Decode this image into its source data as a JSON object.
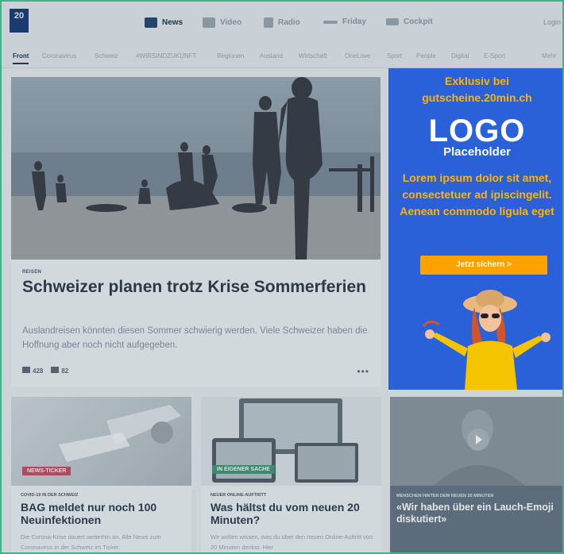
{
  "nav": {
    "logo": "20",
    "items": [
      {
        "label": "News",
        "icon": "news-grid-icon"
      },
      {
        "label": "Video",
        "icon": "video-play-icon"
      },
      {
        "label": "Radio",
        "icon": "radio-icon"
      },
      {
        "label": "Friday",
        "icon": "friday-icon"
      },
      {
        "label": "Cockpit",
        "icon": "cockpit-icon"
      }
    ],
    "login": "Login"
  },
  "subnav": [
    "Front",
    "Coronavirus",
    "Schweiz",
    "#WIRSINDZUKUNFT",
    "Regionen",
    "Ausland",
    "Wirtschaft",
    "OneLove",
    "Sport",
    "People",
    "Digital",
    "E-Sport",
    "Mehr"
  ],
  "hero": {
    "kicker": "REISEN",
    "headline": "Schweizer planen trotz Krise Sommerferien",
    "lead": "Auslandreisen könnten diesen Sommer schwierig werden. Viele Schweizer haben die Hoffnung aber noch nicht aufgegeben.",
    "likes": "428",
    "shares": "82",
    "more": "•••"
  },
  "ad": {
    "title": "Exklusiv bei gutscheine.20min.ch",
    "logo_big": "LOGO",
    "logo_small": "Placeholder",
    "body": "Lorem ipsum dolor sit amet, consectetuer ad ipiscingelit. Aenean commodo ligula eget",
    "button": "Jetzt sichern  >"
  },
  "cards": [
    {
      "tag": "NEWS-TICKER",
      "kicker": "COVID-19 IN DER SCHWEIZ",
      "headline": "BAG meldet nur noch 100 Neuinfektionen",
      "text": "Die Corona-Krise dauert weiterhin an. Alle News zum Coronavirus in der Schweiz im Ticker."
    },
    {
      "tag": "IN EIGENER SACHE",
      "kicker": "NEUER ONLINE-AUFTRITT",
      "headline": "Was hältst du vom neuen 20 Minuten?",
      "text": "Wir wollen wissen, was du über den neuen Online-Auftritt von 20 Minuten denkst. Hier"
    }
  ],
  "video": {
    "kicker": "MENSCHEN HINTER DEM NEUEN 20 MINUTEN",
    "headline": "«Wir haben über ein Lauch-Emoji diskutiert»"
  },
  "colors": {
    "accent": "#ffb400",
    "ad_bg": "#2a61d8",
    "tag_red": "#b04a5e",
    "tag_green": "#3d8a6e"
  }
}
